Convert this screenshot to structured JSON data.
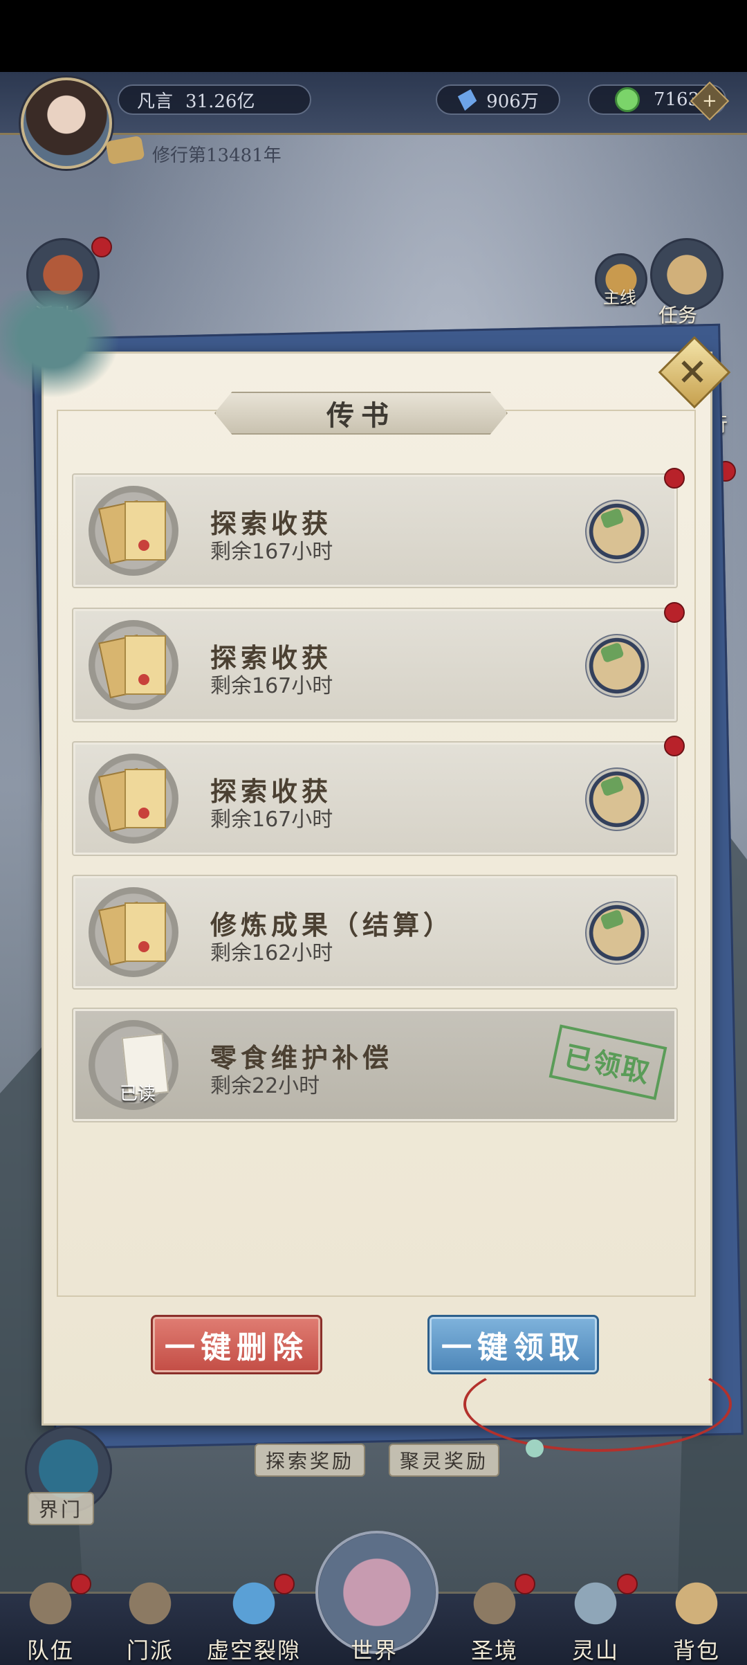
{
  "header": {
    "player_name": "凡言",
    "power": "31.26亿",
    "crystal": "906万",
    "jade": "7163",
    "plus": "+",
    "cultivation": "修行第13481年"
  },
  "side": {
    "activity": "活动",
    "mainline": "主线",
    "tasks": "任务",
    "right_partial": "行"
  },
  "dialog": {
    "title": "传书",
    "close": "×",
    "mails": [
      {
        "title": "探索收获",
        "time": "剩余167小时",
        "unread": true
      },
      {
        "title": "探索收获",
        "time": "剩余167小时",
        "unread": true
      },
      {
        "title": "探索收获",
        "time": "剩余167小时",
        "unread": true
      },
      {
        "title": "修炼成果（结算）",
        "time": "剩余162小时",
        "unread": false
      },
      {
        "title": "零食维护补偿",
        "time": "剩余22小时",
        "read_badge": "已读",
        "stamp": "已领取"
      }
    ],
    "delete_all": "一键删除",
    "claim_all": "一键领取"
  },
  "lower": {
    "explore_reward": "探索奖励",
    "gather_reward": "聚灵奖励",
    "realm_gate": "界门"
  },
  "nav": {
    "items": [
      "队伍",
      "门派",
      "虚空裂隙",
      "世界",
      "圣境",
      "灵山",
      "背包"
    ]
  }
}
